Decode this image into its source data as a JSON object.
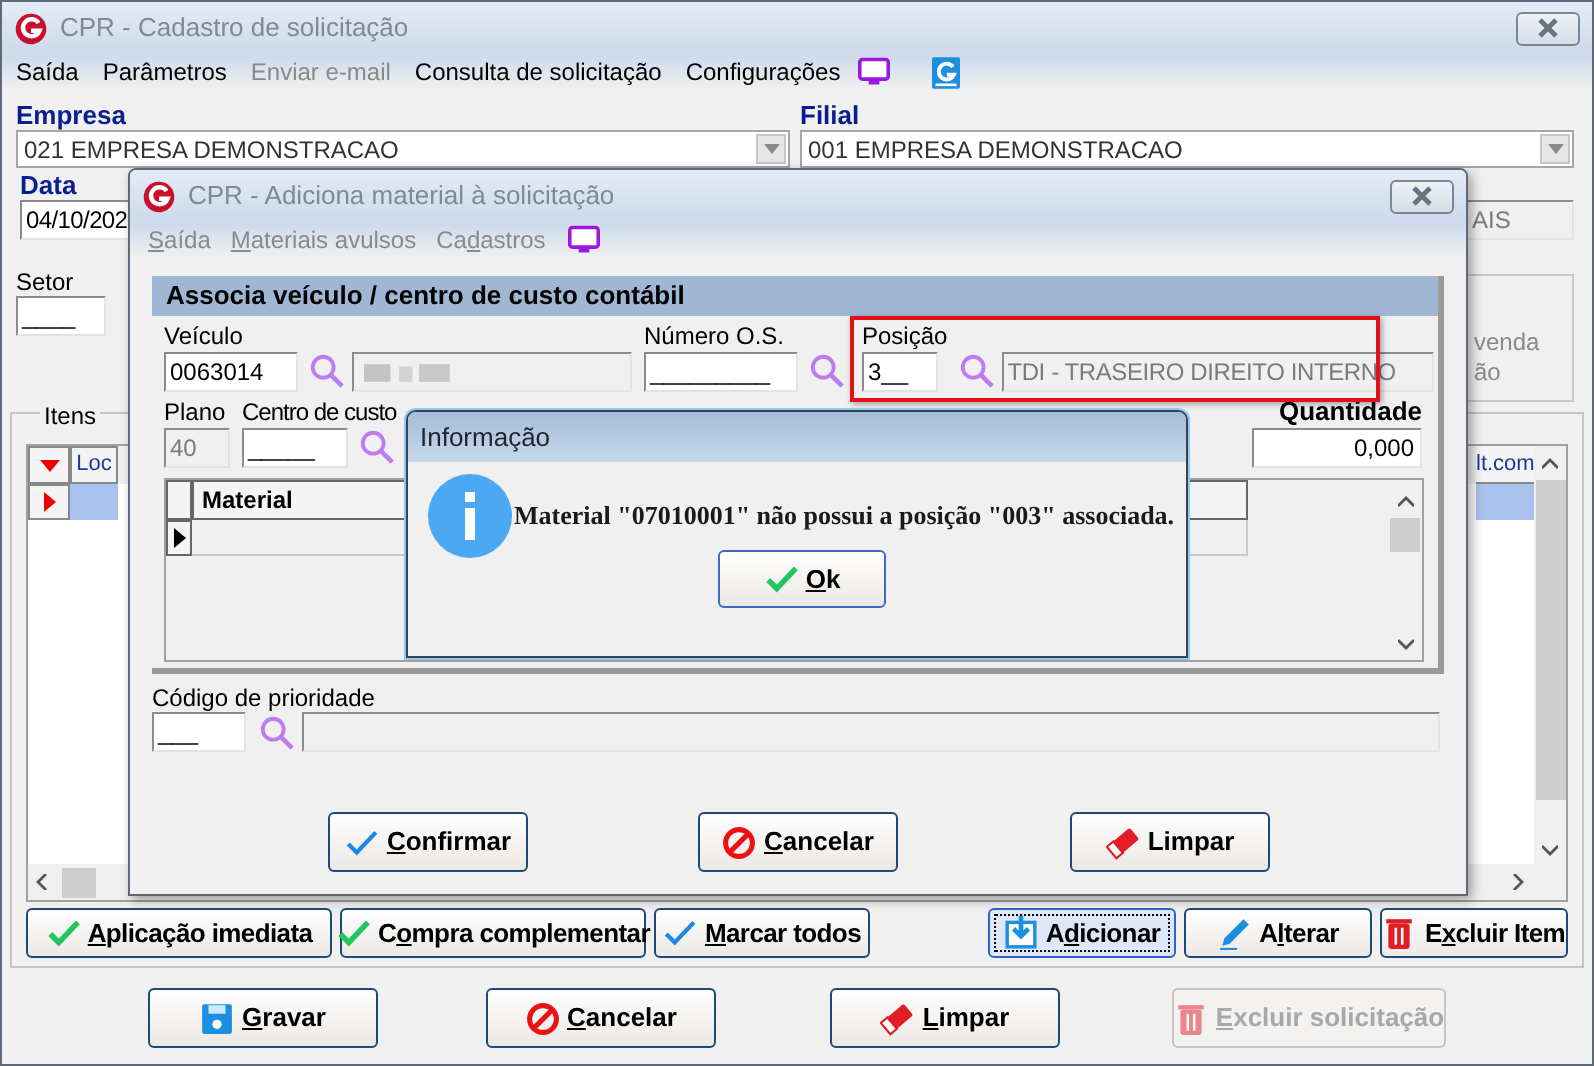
{
  "main_window": {
    "title": "CPR - Cadastro de solicitação",
    "menu": [
      {
        "label": "Saída",
        "disabled": false
      },
      {
        "label": "Parâmetros",
        "disabled": false
      },
      {
        "label": "Enviar e-mail",
        "disabled": true
      },
      {
        "label": "Consulta de solicitação",
        "disabled": false
      },
      {
        "label": "Configurações",
        "disabled": false
      }
    ],
    "empresa": {
      "label": "Empresa",
      "value": "021 EMPRESA DEMONSTRACAO"
    },
    "filial": {
      "label": "Filial",
      "value": "001 EMPRESA DEMONSTRACAO"
    },
    "data": {
      "label": "Data",
      "value": "04/10/202"
    },
    "field_right": {
      "value": "AIS"
    },
    "setor": {
      "label": "Setor",
      "value": "____"
    },
    "side_panel_lines": [
      "venda",
      "ão"
    ],
    "itens": {
      "label": "Itens",
      "columns": [
        "Loc",
        "lt.com"
      ],
      "rows": [
        {
          "selected": true
        }
      ]
    },
    "item_buttons": [
      {
        "label": "Aplicação imediata",
        "kind": "check-green",
        "focused": false
      },
      {
        "label": "Compra complementar",
        "kind": "check-green",
        "focused": false
      },
      {
        "label": "Marcar todos",
        "kind": "check-blue",
        "focused": false
      },
      {
        "label": "Adicionar",
        "kind": "add",
        "focused": true
      },
      {
        "label": "Alterar",
        "kind": "pencil",
        "focused": false
      },
      {
        "label": "Excluir Item",
        "kind": "trash",
        "focused": false
      }
    ],
    "buttons": [
      {
        "label": "Gravar",
        "kind": "save",
        "disabled": false
      },
      {
        "label": "Cancelar",
        "kind": "stop",
        "disabled": false
      },
      {
        "label": "Limpar",
        "kind": "eraser",
        "disabled": false
      },
      {
        "label": "Excluir solicitação",
        "kind": "trash",
        "disabled": true
      }
    ]
  },
  "add_dialog": {
    "title": "CPR - Adiciona material à solicitação",
    "menu": [
      "Saída",
      "Materiais avulsos",
      "Cadastros"
    ],
    "panel_title": "Associa veículo / centro de custo contábil",
    "veiculo": {
      "label": "Veículo",
      "value": "0063014"
    },
    "numero_os": {
      "label": "Número O.S.",
      "value": "_________"
    },
    "posicao": {
      "label": "Posição",
      "value": "3__",
      "description": "TDI - TRASEIRO DIREITO INTERNO",
      "highlighted": true
    },
    "plano": {
      "label": "Plano",
      "value": "40"
    },
    "centro": {
      "label": "Centro de custo",
      "value": "_____"
    },
    "quantidade": {
      "label": "Quantidade",
      "value": "0,000"
    },
    "grid": {
      "columns": [
        "Material"
      ]
    },
    "prioridade": {
      "label": "Código de prioridade",
      "value": "___"
    },
    "buttons": [
      {
        "label": "Confirmar",
        "kind": "check-blue"
      },
      {
        "label": "Cancelar",
        "kind": "stop"
      },
      {
        "label": "Limpar",
        "kind": "eraser"
      }
    ]
  },
  "info_dialog": {
    "title": "Informação",
    "message": "Material \"07010001\" não possui a posição \"003\" associada.",
    "button": {
      "label": "Ok"
    }
  }
}
